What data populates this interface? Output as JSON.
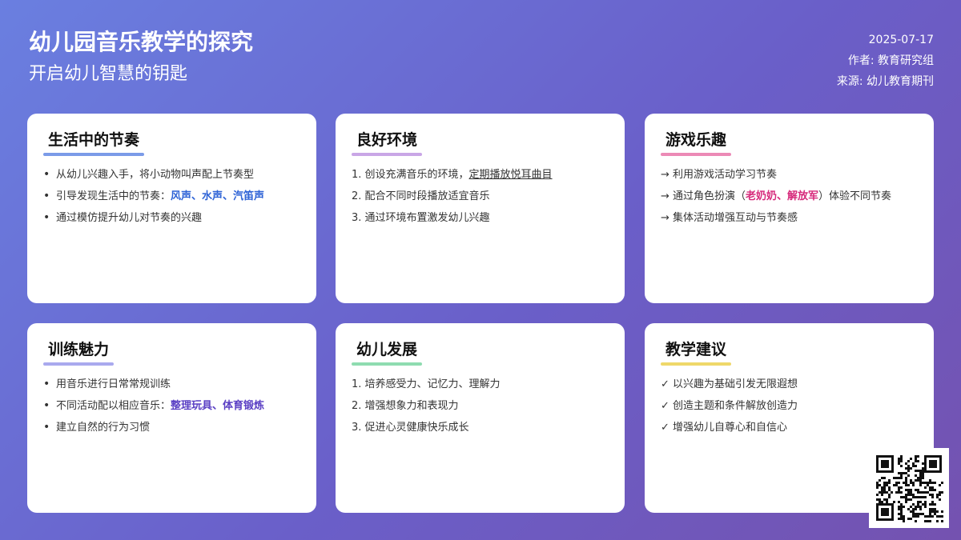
{
  "header": {
    "title": "幼儿园音乐教学的探究",
    "subtitle": "开启幼儿智慧的钥匙",
    "date": "2025-07-17",
    "author": "作者: 教育研究组",
    "source": "来源: 幼儿教育期刊"
  },
  "cards": [
    {
      "title": "生活中的节奏",
      "accent": "#7b9be8",
      "items": [
        "从幼儿兴趣入手，将小动物叫声配上节奏型",
        "引导发现生活中的节奏：",
        "通过模仿提升幼儿对节奏的兴趣"
      ],
      "item2_highlight": "风声、水声、汽笛声"
    },
    {
      "title": "良好环境",
      "accent": "#c9a6e6",
      "items": [
        "1. 创设充满音乐的环境，",
        "2. 配合不同时段播放适宜音乐",
        "3. 通过环境布置激发幼儿兴趣"
      ],
      "item1_underline": "定期播放悦耳曲目"
    },
    {
      "title": "游戏乐趣",
      "accent": "#ec8ab6",
      "items": [
        "→ 利用游戏活动学习节奏",
        "→ 通过角色扮演（",
        "）体验不同节奏",
        "→ 集体活动增强互动与节奏感"
      ],
      "item2_highlight": "老奶奶、解放军"
    },
    {
      "title": "训练魅力",
      "accent": "#a9a9ee",
      "items": [
        "用音乐进行日常常规训练",
        "不同活动配以相应音乐：",
        "建立自然的行为习惯"
      ],
      "item2_highlight": "整理玩具、体育锻炼"
    },
    {
      "title": "幼儿发展",
      "accent": "#8fdcb0",
      "items": [
        "1. 培养感受力、记忆力、理解力",
        "2. 增强想象力和表现力",
        "3. 促进心灵健康快乐成长"
      ]
    },
    {
      "title": "教学建议",
      "accent": "#efd86a",
      "items": [
        "✓ 以兴趣为基础引发无限遐想",
        "✓ 创造主题和条件解放创造力",
        "✓ 增强幼儿自尊心和自信心"
      ]
    }
  ],
  "colors": {
    "blue_highlight": "#2e63d6",
    "pink_highlight": "#d6287a",
    "purple_highlight": "#5a3fc4"
  },
  "qr_icon": "qr-code-icon"
}
